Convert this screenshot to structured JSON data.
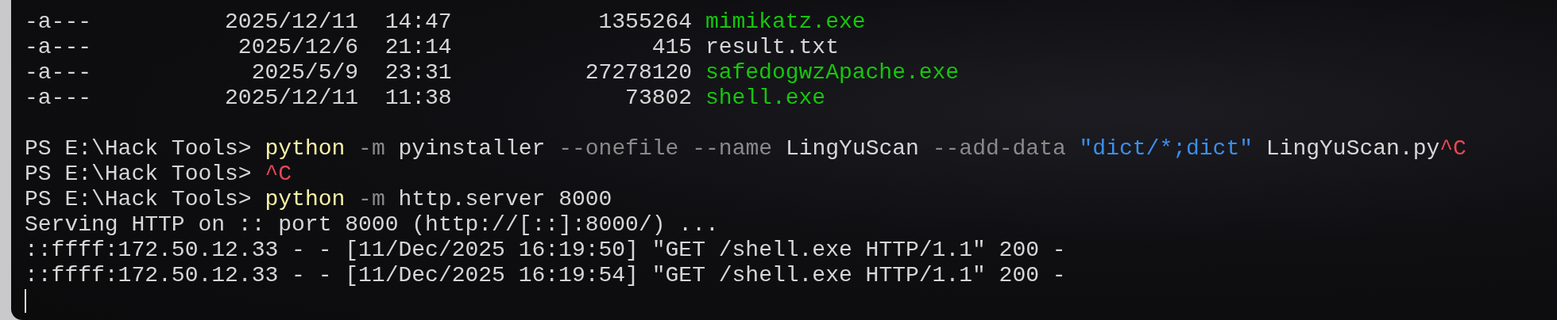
{
  "listing": [
    {
      "mode": "-a---",
      "date": "2025/12/11",
      "time": "14:47",
      "length": "1355264",
      "name": "mimikatz.exe",
      "kind": "executable"
    },
    {
      "mode": "-a---",
      "date": "2025/12/6",
      "time": "21:14",
      "length": "415",
      "name": "result.txt",
      "kind": "plain"
    },
    {
      "mode": "-a---",
      "date": "2025/5/9",
      "time": "23:31",
      "length": "27278120",
      "name": "safedogwzApache.exe",
      "kind": "executable"
    },
    {
      "mode": "-a---",
      "date": "2025/12/11",
      "time": "11:38",
      "length": "73802",
      "name": "shell.exe",
      "kind": "executable"
    }
  ],
  "lines": [
    {
      "segments": [
        {
          "text": "PS E:\\Hack Tools>",
          "kind": "prompt"
        },
        {
          "text": "python",
          "kind": "command"
        },
        {
          "text": "-m",
          "kind": "flag"
        },
        {
          "text": "pyinstaller",
          "kind": "arg"
        },
        {
          "text": "--onefile",
          "kind": "flag"
        },
        {
          "text": "--name",
          "kind": "flag"
        },
        {
          "text": "LingYuScan",
          "kind": "arg"
        },
        {
          "text": "--add-data",
          "kind": "flag"
        },
        {
          "text": "\"dict/*;dict\"",
          "kind": "string"
        },
        {
          "text": "LingYuScan.py",
          "kind": "arg"
        },
        {
          "text": "^C",
          "kind": "interrupt",
          "attached": true
        }
      ]
    },
    {
      "segments": [
        {
          "text": "PS E:\\Hack Tools>",
          "kind": "prompt"
        },
        {
          "text": "^C",
          "kind": "interrupt"
        }
      ]
    },
    {
      "segments": [
        {
          "text": "PS E:\\Hack Tools>",
          "kind": "prompt"
        },
        {
          "text": "python",
          "kind": "command"
        },
        {
          "text": "-m",
          "kind": "flag"
        },
        {
          "text": "http.server",
          "kind": "arg"
        },
        {
          "text": "8000",
          "kind": "arg"
        }
      ]
    },
    {
      "segments": [
        {
          "text": "Serving HTTP on :: port 8000 (http://[::]:8000/) ...",
          "kind": "output"
        }
      ]
    },
    {
      "segments": [
        {
          "text": "::ffff:172.50.12.33 - - [11/Dec/2025 16:19:50] \"GET /shell.exe HTTP/1.1\" 200 -",
          "kind": "output"
        }
      ]
    },
    {
      "segments": [
        {
          "text": "::ffff:172.50.12.33 - - [11/Dec/2025 16:19:54] \"GET /shell.exe HTTP/1.1\" 200 -",
          "kind": "output"
        }
      ]
    }
  ]
}
